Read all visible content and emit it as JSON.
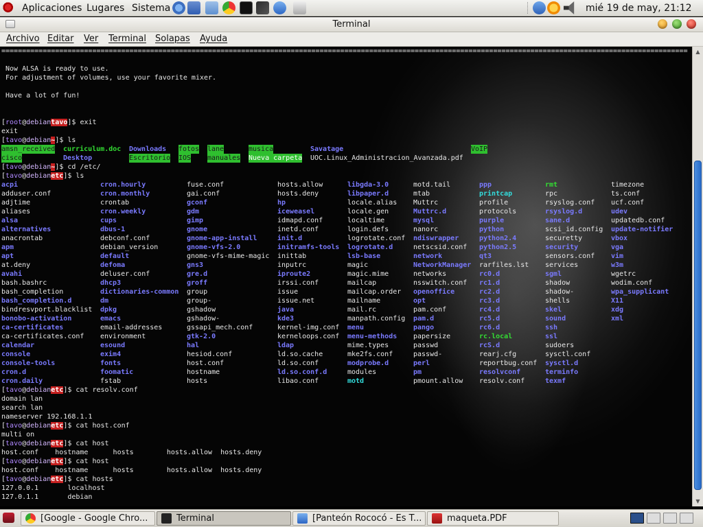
{
  "top_panel": {
    "menus": [
      "Aplicaciones",
      "Lugares",
      "Sistema"
    ],
    "launchers": [
      "debian-help-icon",
      "notes-icon",
      "folder-icon",
      "chrome-icon",
      "terminal-icon",
      "music-icon",
      "network-icon"
    ],
    "tray": [
      "music-tray-icon",
      "update-notifier-icon",
      "volume-icon"
    ],
    "clock": "mié 19 de may, 21:12"
  },
  "window": {
    "title": "Terminal",
    "menu": [
      "Archivo",
      "Editar",
      "Ver",
      "Terminal",
      "Solapas",
      "Ayuda"
    ]
  },
  "terminal": {
    "prompt": {
      "open": "[",
      "user": "root",
      "at": "@",
      "host": "debian",
      "close": "]$ "
    },
    "rule": "==================================================================================================================================================================================",
    "alsa_lines": [
      "Now ALSA is ready to use.",
      "For adjustment of volumes, use your favorite mixer.",
      "",
      "Have a lot of fun!"
    ],
    "session": [
      {
        "type": "prompt",
        "user": "root",
        "dir": "tavo",
        "cmd": "exit"
      },
      {
        "type": "text",
        "text": "exit"
      },
      {
        "type": "prompt",
        "user": "tavo",
        "dir": "~",
        "cmd": "ls"
      },
      {
        "type": "lsgrid",
        "id": "home"
      },
      {
        "type": "prompt",
        "user": "tavo",
        "dir": "~",
        "cmd": "cd /etc/"
      },
      {
        "type": "prompt",
        "user": "tavo",
        "dir": "etc",
        "cmd": "ls"
      },
      {
        "type": "lsgrid",
        "id": "etc"
      },
      {
        "type": "prompt",
        "user": "tavo",
        "dir": "etc",
        "cmd": "cat resolv.conf"
      },
      {
        "type": "text",
        "text": "domain lan"
      },
      {
        "type": "text",
        "text": "search lan"
      },
      {
        "type": "text",
        "text": "nameserver 192.168.1.1"
      },
      {
        "type": "prompt",
        "user": "tavo",
        "dir": "etc",
        "cmd": "cat host.conf"
      },
      {
        "type": "text",
        "text": "multi on"
      },
      {
        "type": "prompt",
        "user": "tavo",
        "dir": "etc",
        "cmd": "cat host"
      },
      {
        "type": "text",
        "text": "host.conf    hostname      hosts        hosts.allow  hosts.deny"
      },
      {
        "type": "prompt",
        "user": "tavo",
        "dir": "etc",
        "cmd": "cat host"
      },
      {
        "type": "text",
        "text": "host.conf    hostname      hosts        hosts.allow  hosts.deny"
      },
      {
        "type": "prompt",
        "user": "tavo",
        "dir": "etc",
        "cmd": "cat hosts"
      },
      {
        "type": "text",
        "text": "127.0.0.1       localhost"
      },
      {
        "type": "text",
        "text": "127.0.1.1       debian"
      }
    ],
    "home_ls": {
      "columns": [
        2,
        92,
        188,
        260,
        302,
        362,
        452,
        686
      ],
      "rows": [
        [
          [
            "amsn_received",
            "cg"
          ],
          [
            "curriculum.doc",
            "cx"
          ],
          [
            "Downloads",
            "cd"
          ],
          [
            "fotos",
            "cg"
          ],
          [
            "lane",
            "cg"
          ],
          [
            "musica",
            "cg"
          ],
          [
            "Savatage",
            "cd"
          ],
          [
            "VoIP",
            "cg"
          ]
        ],
        [
          [
            "cisco",
            "cg"
          ],
          [
            "Desktop",
            "cd"
          ],
          [
            "Escritorio",
            "cg"
          ],
          [
            "IOS",
            "cg"
          ],
          [
            "manuales",
            "cg"
          ],
          [
            "Nueva carpeta",
            "cgb"
          ],
          [
            "UOC.Linux_Administracion_Avanzada.pdf",
            "cf"
          ]
        ]
      ]
    },
    "etc_ls": {
      "columns": [
        [
          "acpi:cd",
          "adduser.conf:cf",
          "adjtime:cf",
          "aliases:cf",
          "alsa:cd",
          "alternatives:cd",
          "anacrontab:cf",
          "apm:cd",
          "apt:cd",
          "at.deny:cf",
          "avahi:cd",
          "bash.bashrc:cf",
          "bash_completion:cf",
          "bash_completion.d:cd",
          "bindresvport.blacklist:cf",
          "bonobo-activation:cd",
          "ca-certificates:cd",
          "ca-certificates.conf:cf",
          "calendar:cd",
          "console:cd",
          "console-tools:cd",
          "cron.d:cd",
          "cron.daily:cd"
        ],
        [
          "cron.hourly:cd",
          "cron.monthly:cd",
          "crontab:cf",
          "cron.weekly:cd",
          "cups:cd",
          "dbus-1:cd",
          "debconf.conf:cf",
          "debian_version:cf",
          "default:cd",
          "defoma:cd",
          "deluser.conf:cf",
          "dhcp3:cd",
          "dictionaries-common:cd",
          "dm:cd",
          "dpkg:cd",
          "emacs:cd",
          "email-addresses:cf",
          "environment:cf",
          "esound:cd",
          "exim4:cd",
          "fonts:cd",
          "foomatic:cd",
          "fstab:cf"
        ],
        [
          "fuse.conf:cf",
          "gai.conf:cf",
          "gconf:cd",
          "gdm:cd",
          "gimp:cd",
          "gnome:cd",
          "gnome-app-install:cd",
          "gnome-vfs-2.0:cd",
          "gnome-vfs-mime-magic:cf",
          "gns3:cd",
          "gre.d:cd",
          "groff:cd",
          "group:cf",
          "group-:cf",
          "gshadow:cf",
          "gshadow-:cf",
          "gssapi_mech.conf:cf",
          "gtk-2.0:cd",
          "hal:cd",
          "hesiod.conf:cf",
          "host.conf:cf",
          "hostname:cf",
          "hosts:cf"
        ],
        [
          "hosts.allow:cf",
          "hosts.deny:cf",
          "hp:cd",
          "iceweasel:cd",
          "idmapd.conf:cf",
          "inetd.conf:cf",
          "init.d:cd",
          "initramfs-tools:cd",
          "inittab:cf",
          "inputrc:cf",
          "iproute2:cd",
          "irssi.conf:cf",
          "issue:cf",
          "issue.net:cf",
          "java:cd",
          "kde3:cd",
          "kernel-img.conf:cf",
          "kerneloops.conf:cf",
          "ldap:cd",
          "ld.so.cache:cf",
          "ld.so.conf:cf",
          "ld.so.conf.d:cd",
          "libao.conf:cf"
        ],
        [
          "libgda-3.0:cd",
          "libpaper.d:cd",
          "locale.alias:cf",
          "locale.gen:cf",
          "localtime:cf",
          "login.defs:cf",
          "logrotate.conf:cf",
          "logrotate.d:cd",
          "lsb-base:cd",
          "magic:cf",
          "magic.mime:cf",
          "mailcap:cf",
          "mailcap.order:cf",
          "mailname:cf",
          "mail.rc:cf",
          "manpath.config:cf",
          "menu:cd",
          "menu-methods:cd",
          "mime.types:cf",
          "mke2fs.conf:cf",
          "modprobe.d:cd",
          "modules:cf",
          "motd:cc"
        ],
        [
          "motd.tail:cf",
          "mtab:cf",
          "Muttrc:cf",
          "Muttrc.d:cd",
          "mysql:cd",
          "nanorc:cf",
          "ndiswrapper:cd",
          "netscsid.conf:cf",
          "network:cd",
          "NetworkManager:cd",
          "networks:cf",
          "nsswitch.conf:cf",
          "openoffice:cd",
          "opt:cd",
          "pam.conf:cf",
          "pam.d:cd",
          "pango:cd",
          "papersize:cf",
          "passwd:cf",
          "passwd-:cf",
          "perl:cd",
          "pm:cd",
          "pmount.allow:cf"
        ],
        [
          "ppp:cd",
          "printcap:cc",
          "profile:cf",
          "protocols:cf",
          "purple:cd",
          "python:cd",
          "python2.4:cd",
          "python2.5:cd",
          "qt3:cd",
          "rarfiles.lst:cf",
          "rc0.d:cd",
          "rc1.d:cd",
          "rc2.d:cd",
          "rc3.d:cd",
          "rc4.d:cd",
          "rc5.d:cd",
          "rc6.d:cd",
          "rc.local:cx",
          "rcS.d:cd",
          "rearj.cfg:cf",
          "reportbug.conf:cf",
          "resolvconf:cd",
          "resolv.conf:cf"
        ],
        [
          "rmt:cx",
          "rpc:cf",
          "rsyslog.conf:cf",
          "rsyslog.d:cd",
          "sane.d:cd",
          "scsi_id.config:cf",
          "securetty:cf",
          "security:cd",
          "sensors.conf:cf",
          "services:cf",
          "sgml:cd",
          "shadow:cf",
          "shadow-:cf",
          "shells:cf",
          "skel:cd",
          "sound:cd",
          "ssh:cd",
          "ssl:cd",
          "sudoers:cf",
          "sysctl.conf:cf",
          "sysctl.d:cd",
          "terminfo:cd",
          "texmf:cd"
        ],
        [
          "timezone:cf",
          "ts.conf:cf",
          "ucf.conf:cf",
          "udev:cd",
          "updatedb.conf:cf",
          "update-notifier:cd",
          "vbox:cd",
          "vga:cd",
          "vim:cd",
          "w3m:cd",
          "wgetrc:cf",
          "wodim.conf:cf",
          "wpa_supplicant:cd",
          "X11:cd",
          "xdg:cd",
          "xml:cd"
        ]
      ],
      "xs": [
        2,
        146,
        272,
        404,
        506,
        602,
        698,
        794,
        890
      ]
    }
  },
  "taskbar": {
    "items": [
      {
        "label": "[Google - Google Chro...",
        "icon": "chrome-icon",
        "active": false
      },
      {
        "label": "Terminal",
        "icon": "terminal-icon",
        "active": true
      },
      {
        "label": "[Panteón Rococó - Es T...",
        "icon": "music-icon",
        "active": false
      },
      {
        "label": "maqueta.PDF",
        "icon": "pdf-icon",
        "active": false
      }
    ]
  }
}
